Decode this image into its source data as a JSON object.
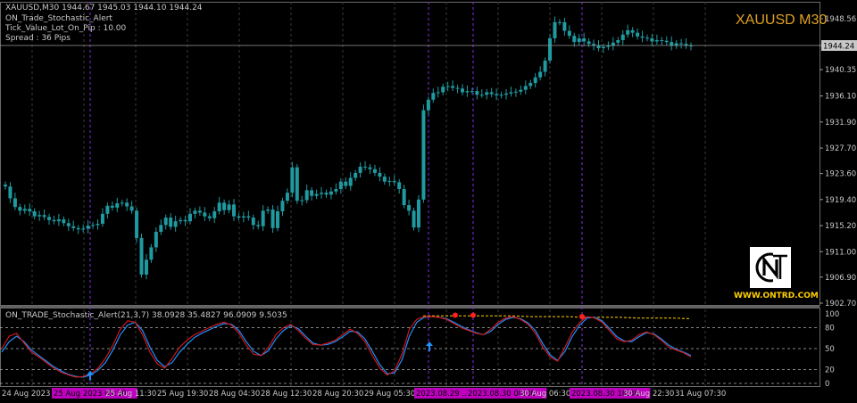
{
  "header": {
    "symbol_line": "XAUUSD,M30  1944.67 1945.03 1944.10 1944.24",
    "indicator_name": "ON_Trade_Stochastic_Alert",
    "tick_value": "Tick_Value_Lot_On_Pip : 10.00",
    "spread": "Spread : 36  Pips",
    "big_title": "XAUUSD M30"
  },
  "branding": {
    "logo_letter": "N",
    "website": "WWW.ONTRD.COM"
  },
  "subwindow": {
    "label": "ON_TRADE_Stochastic_Alert(21,3,7) 38.0928 35.4827 96.0909 9.5035"
  },
  "colors": {
    "background": "#000000",
    "candle": "#1f9aa0",
    "grid": "#3a3a3a",
    "vline_magenta": "#8a2be2",
    "stoch_main": "#d01818",
    "stoch_signal": "#1e90ff",
    "upper_dashed": "#ffd000",
    "axis_text": "#c8c8c8",
    "date_highlight": "#c000c0"
  },
  "chart_data": [
    {
      "type": "candlestick",
      "title": "XAUUSD M30",
      "ylim": [
        1902.7,
        1951.0
      ],
      "y_ticks": [
        "1948.56",
        "1944.24",
        "1940.35",
        "1936.10",
        "1931.90",
        "1927.70",
        "1923.60",
        "1919.40",
        "1915.20",
        "1911.00",
        "1906.90",
        "1902.70"
      ],
      "current_price": 1944.24,
      "close": [
        1921.5,
        1919.6,
        1918.2,
        1917.6,
        1917.9,
        1917.5,
        1916.7,
        1916.9,
        1916.6,
        1916.1,
        1915.9,
        1916.2,
        1915.6,
        1915.1,
        1914.8,
        1914.6,
        1914.7,
        1915.2,
        1915.3,
        1915.5,
        1917.1,
        1918.4,
        1918.1,
        1918.8,
        1918.9,
        1918.3,
        1917.6,
        1913.2,
        1907.3,
        1909.7,
        1911.7,
        1914.2,
        1915.3,
        1916.5,
        1915.0,
        1915.9,
        1916.1,
        1915.9,
        1917.1,
        1917.6,
        1917.3,
        1916.7,
        1916.4,
        1917.5,
        1918.9,
        1917.7,
        1918.6,
        1916.7,
        1916.5,
        1916.7,
        1916.5,
        1915.3,
        1915.1,
        1917.6,
        1917.8,
        1914.8,
        1917.5,
        1919.2,
        1920.5,
        1924.6,
        1919.2,
        1919.3,
        1920.9,
        1920.0,
        1920.3,
        1920.5,
        1920.2,
        1920.7,
        1921.1,
        1922.3,
        1921.6,
        1922.9,
        1923.7,
        1924.7,
        1924.6,
        1924.3,
        1923.7,
        1923.1,
        1922.3,
        1922.4,
        1922.2,
        1921.1,
        1918.5,
        1917.6,
        1914.9,
        1919.4,
        1933.8,
        1935.5,
        1936.6,
        1936.7,
        1937.6,
        1937.7,
        1937.4,
        1937.3,
        1936.7,
        1936.9,
        1936.9,
        1936.3,
        1936.3,
        1936.7,
        1936.4,
        1936.2,
        1936.3,
        1936.5,
        1936.7,
        1936.8,
        1937.1,
        1937.7,
        1938.2,
        1939.1,
        1940.0,
        1941.8,
        1945.4,
        1948.0,
        1948.0,
        1946.6,
        1945.8,
        1944.8,
        1945.4,
        1944.9,
        1944.5,
        1944.2,
        1943.8,
        1944.0,
        1944.2,
        1944.7,
        1945.1,
        1946.0,
        1946.7,
        1946.3,
        1945.7,
        1945.5,
        1945.4,
        1944.9,
        1945.1,
        1945.0,
        1944.8,
        1944.2,
        1944.6,
        1944.5,
        1944.2,
        1944.24
      ],
      "x_tick_labels": [
        "24 Aug 2023",
        "25 Aug 2023 05:30",
        "25 Aug 11:30",
        "25 Aug 19:30",
        "28 Aug 04:30",
        "28 Aug 12:30",
        "28 Aug 20:30",
        "29 Aug 05:30",
        "2023.08.29 ...",
        "2023.08.30 00:30",
        "30 Aug 06:30",
        "2023.08.30 18:30",
        "30 Aug 22:30",
        "31 Aug 07:30"
      ]
    },
    {
      "type": "line",
      "title": "ON_TRADE_Stochastic_Alert(21,3,7)",
      "ylim": [
        0,
        100
      ],
      "y_ticks": [
        "100",
        "80",
        "50",
        "20",
        "0"
      ],
      "series": [
        {
          "name": "main",
          "values": [
            50,
            68,
            72,
            58,
            45,
            38,
            30,
            22,
            16,
            12,
            9,
            10,
            14,
            22,
            36,
            55,
            78,
            90,
            88,
            70,
            45,
            28,
            22,
            36,
            52,
            62,
            70,
            75,
            80,
            85,
            88,
            84,
            72,
            55,
            42,
            40,
            52,
            70,
            80,
            85,
            76,
            65,
            56,
            55,
            58,
            62,
            70,
            78,
            72,
            60,
            40,
            22,
            12,
            18,
            42,
            78,
            92,
            96,
            96,
            95,
            92,
            86,
            80,
            76,
            72,
            70,
            78,
            88,
            94,
            96,
            92,
            85,
            72,
            52,
            38,
            32,
            52,
            74,
            88,
            96,
            94,
            88,
            76,
            64,
            60,
            62,
            70,
            74,
            70,
            62,
            52,
            48,
            44,
            38
          ]
        },
        {
          "name": "signal",
          "values": [
            45,
            60,
            68,
            60,
            48,
            40,
            32,
            24,
            18,
            13,
            10,
            9,
            12,
            19,
            30,
            48,
            70,
            84,
            88,
            76,
            52,
            33,
            24,
            30,
            45,
            56,
            66,
            72,
            77,
            82,
            86,
            85,
            76,
            60,
            46,
            40,
            47,
            64,
            76,
            83,
            79,
            68,
            58,
            55,
            56,
            60,
            67,
            75,
            74,
            64,
            46,
            27,
            14,
            15,
            34,
            68,
            88,
            95,
            96,
            95,
            93,
            88,
            82,
            77,
            73,
            70,
            75,
            85,
            92,
            95,
            93,
            87,
            76,
            57,
            41,
            33,
            46,
            68,
            84,
            94,
            95,
            90,
            79,
            67,
            61,
            60,
            67,
            73,
            71,
            64,
            55,
            49,
            45,
            40
          ]
        },
        {
          "name": "overbought_level",
          "values": [
            97,
            97,
            97,
            97,
            97,
            97,
            96,
            96,
            96,
            95,
            95,
            95,
            94,
            94,
            94,
            93
          ]
        }
      ]
    }
  ]
}
